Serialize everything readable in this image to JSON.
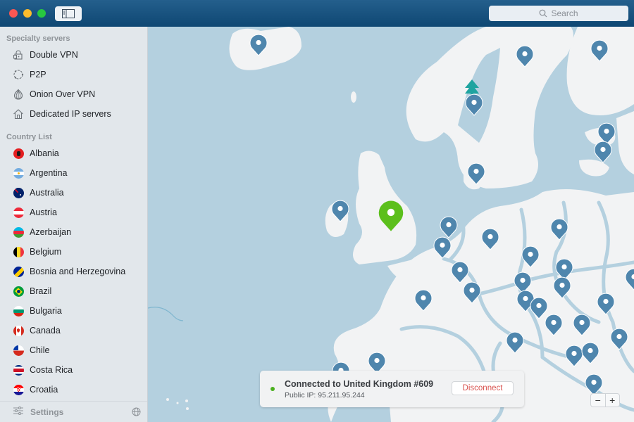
{
  "window": {
    "search_placeholder": "Search"
  },
  "sidebar": {
    "specialty_label": "Specialty servers",
    "specialty": [
      {
        "label": "Double VPN",
        "icon": "lock-icon"
      },
      {
        "label": "P2P",
        "icon": "p2p-icon"
      },
      {
        "label": "Onion Over VPN",
        "icon": "onion-icon"
      },
      {
        "label": "Dedicated IP servers",
        "icon": "house-icon"
      }
    ],
    "country_label": "Country List",
    "countries": [
      {
        "label": "Albania",
        "flag": "albania"
      },
      {
        "label": "Argentina",
        "flag": "argentina"
      },
      {
        "label": "Australia",
        "flag": "australia"
      },
      {
        "label": "Austria",
        "flag": "austria"
      },
      {
        "label": "Azerbaijan",
        "flag": "azerbaijan"
      },
      {
        "label": "Belgium",
        "flag": "belgium"
      },
      {
        "label": "Bosnia and Herzegovina",
        "flag": "bosnia"
      },
      {
        "label": "Brazil",
        "flag": "brazil"
      },
      {
        "label": "Bulgaria",
        "flag": "bulgaria"
      },
      {
        "label": "Canada",
        "flag": "canada"
      },
      {
        "label": "Chile",
        "flag": "chile"
      },
      {
        "label": "Costa Rica",
        "flag": "costa-rica"
      },
      {
        "label": "Croatia",
        "flag": "croatia"
      }
    ],
    "settings_label": "Settings"
  },
  "status": {
    "title": "Connected to United Kingdom #609",
    "ip": "Public IP: 95.211.95.244",
    "disconnect_label": "Disconnect",
    "connected_color": "#4ab01f"
  },
  "map": {
    "zoom_out_label": "−",
    "zoom_in_label": "+",
    "active_server": "United Kingdom",
    "colors": {
      "sea": "#b4d0df",
      "land": "#f2f3f4",
      "pin": "#4f86ad",
      "pin_active": "#5cbf1c",
      "tree": "#1fa4a0"
    }
  }
}
